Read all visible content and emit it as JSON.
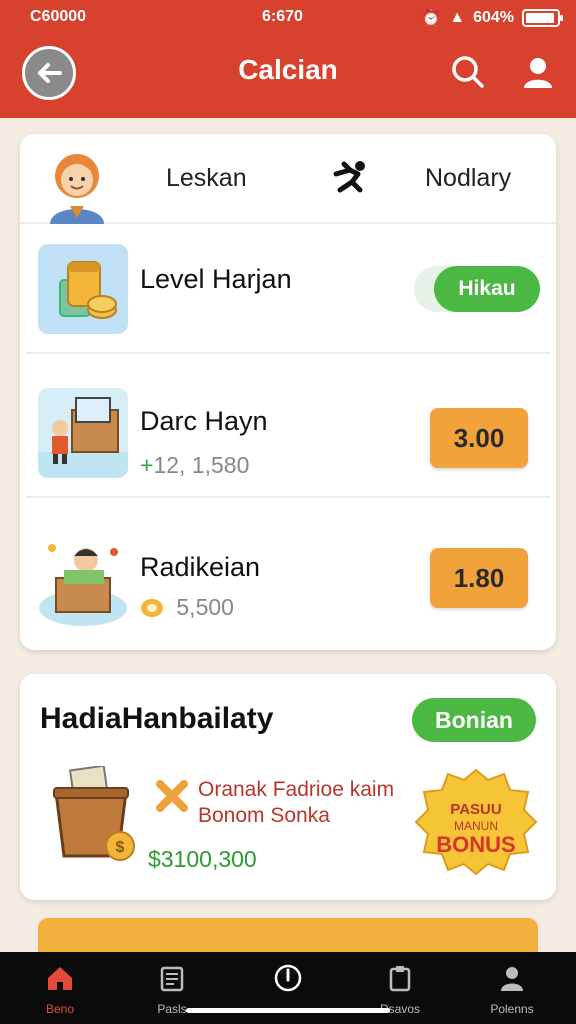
{
  "status_bar": {
    "carrier": "C60000",
    "time": "6:670",
    "battery_text": "604%",
    "battery_level": 0.85
  },
  "header": {
    "title": "Calcian"
  },
  "tabs": {
    "left_label": "Leskan",
    "right_label": "Nodlary"
  },
  "rows": [
    {
      "name": "Level Harjan",
      "toggle_label": "Hikau",
      "icon": "jar-coins-icon"
    },
    {
      "name": "Darc Hayn",
      "sub_prefix": "+",
      "sub": "12, 1,580",
      "price": "3.00",
      "icon": "laptop-box-icon"
    },
    {
      "name": "Radikeian",
      "sub": "5,500",
      "price": "1.80",
      "icon": "boy-box-icon"
    }
  ],
  "bonus_card": {
    "title": "HadiaHanbailaty",
    "pill_label": "Bonian",
    "line1": "Oranak Fadrioe kaim",
    "line2": "Bonom Sonka",
    "amount": "$3100,300",
    "badge_top": "PASUU",
    "badge_mid": "MANUN",
    "badge_text": "BONUS"
  },
  "bottom_nav": [
    {
      "label": "Beno",
      "icon": "home-icon",
      "active": true
    },
    {
      "label": "Pasls",
      "icon": "news-icon"
    },
    {
      "label": "",
      "icon": "compass-icon"
    },
    {
      "label": "Dsavos",
      "icon": "clipboard-icon"
    },
    {
      "label": "Polenns",
      "icon": "profile-icon"
    }
  ],
  "colors": {
    "primary": "#d9412f",
    "green": "#4cb844",
    "orange": "#f2a23a",
    "background": "#f4ece2"
  }
}
